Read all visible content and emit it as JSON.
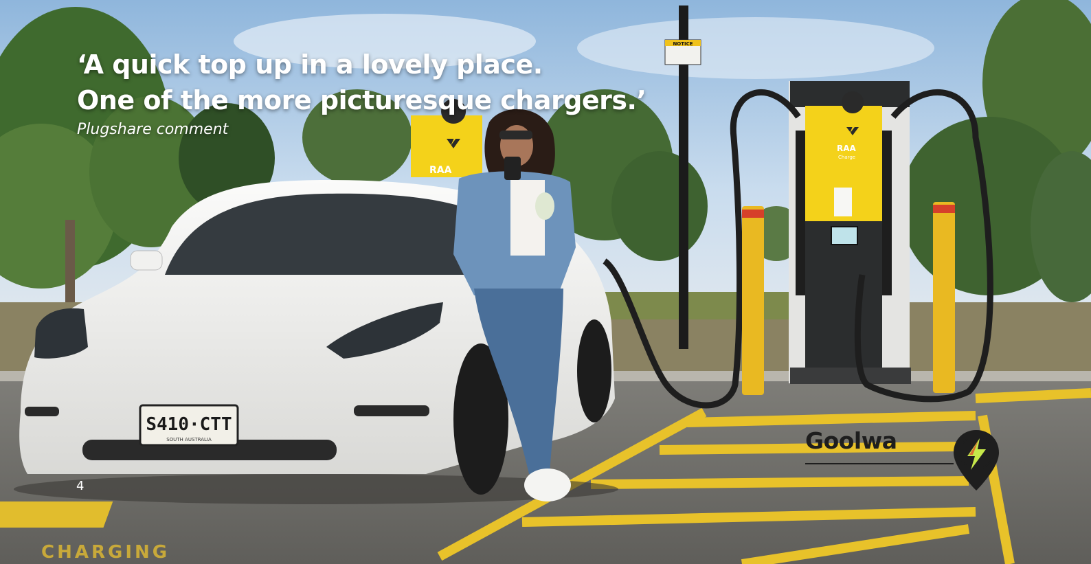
{
  "quote": {
    "line1": "‘A quick top up in a lovely place.",
    "line2": "One of the more picturesque chargers.’",
    "attribution": "Plugshare comment"
  },
  "page_number": "4",
  "location": {
    "name": "Goolwa",
    "pin_icon": "lightning-pin-icon"
  },
  "scene": {
    "charger_brand": "RAA",
    "charger_sub": "Charge",
    "number_plate": "S410·CTT",
    "plate_state": "SOUTH AUSTRALIA",
    "notice_sign": "NOTICE",
    "ground_marking": "CHARGING"
  },
  "colors": {
    "brand_yellow": "#f4d21a",
    "charger_body": "#2b2d2e",
    "sky": "#b9d3ea",
    "pin_lightning": "#c6e84a",
    "car_white": "#f3f3f1",
    "text_dark": "#1e1e1e"
  }
}
